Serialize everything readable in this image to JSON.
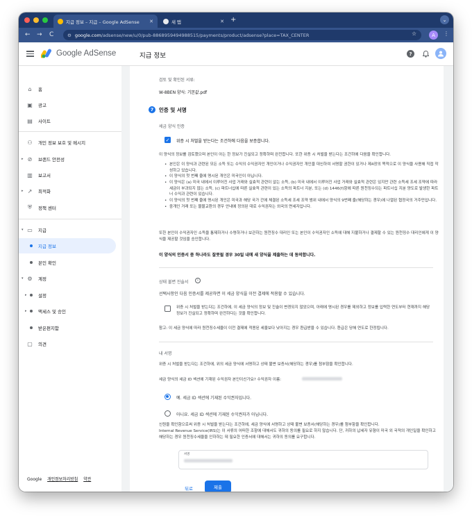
{
  "browser": {
    "tabs": [
      {
        "title": "지급 정보 – 지급 – Google AdSense",
        "close": "✕"
      },
      {
        "title": "새 탭",
        "close": "✕"
      }
    ],
    "new_tab": "+",
    "tab_menu": "⌄",
    "url_domain": "google.com",
    "url_path": "/adsense/new/u/0/pub-8868959494988515/payments/product/adsense?place=TAX_CENTER",
    "profile_initial": "A",
    "nav_back": "←",
    "nav_forward": "→",
    "nav_reload": "C",
    "star": "☆",
    "kebab": "⋮"
  },
  "header": {
    "brand": "Google AdSense",
    "page_title": "지급 정보",
    "help": "?",
    "bell": "🔔",
    "avatar": "👤"
  },
  "sidebar": {
    "items": [
      {
        "label": "홈",
        "icon": "home-icon"
      },
      {
        "label": "광고",
        "icon": "ads-icon"
      },
      {
        "label": "사이트",
        "icon": "sites-icon"
      },
      {
        "label": "개인 정보 보호 및 메시지",
        "icon": "privacy-icon"
      },
      {
        "label": "브랜드 안전성",
        "icon": "block-icon"
      },
      {
        "label": "보고서",
        "icon": "reports-icon"
      },
      {
        "label": "최적화",
        "icon": "optimize-icon"
      },
      {
        "label": "정책 센터",
        "icon": "policy-icon"
      },
      {
        "label": "지급",
        "icon": "payments-icon"
      },
      {
        "label": "지급 정보"
      },
      {
        "label": "본인 확인"
      },
      {
        "label": "계정",
        "icon": "account-icon"
      },
      {
        "label": "설정"
      },
      {
        "label": "액세스 및 승인"
      },
      {
        "label": "받은편지함"
      },
      {
        "label": "의견",
        "icon": "feedback-icon"
      }
    ],
    "footer": {
      "google": "Google",
      "privacy": "개인정보처리방침",
      "terms": "약관"
    }
  },
  "form": {
    "review_docs_label": "검토 및 확인된 서류:",
    "review_docs_value": "W-8BEN 양식: 기본값.pdf",
    "step_number": "7",
    "section_title": "인증 및 서명",
    "tax_form_cert_label": "세금 양식 인증",
    "perjury_checkbox_label": "위증 시 처벌을 받는다는 조건하에 다음을 보증합니다.",
    "intro_paragraph": "이 양식의 정보를 검토했으며 본인이 아는 한 정보가 진실되고 정확하며 완전합니다. 또한 위증 시 처벌을 받는다는 조건하에 다음을 확인합니다.",
    "bullets": [
      "본인은 이 양식과 관련된 모든 소득 또는 수익의 수익권자인 개인이거나 수익권자인 개인을 대신하여 서명할 권한이 있거나 제4장의 목적으로 이 양식을 사용해 직접 작성하고 있습니다.",
      "이 양식의 첫 번째 줄에 명시된 개인은 미국인이 아닙니다.",
      "이 양식은 (a) 미국 내에서 이루어진 사업 거래와 실효적 관련이 없는 소득, (b) 미국 내에서 이루어진 사업 거래와 실효적 관련은 있지만 관련 소득세 조세 조약에 따라 세금이 부과되지 않는 소득, (c) 파트너십에 따른 실효적 관련이 있는 소득의 파트너 지분, 또는 (d) 1446(f)항에 따른 원천징수되는 파트너십 지분 양도로 발생한 파트너 수익과 관련이 있습니다.",
      "이 양식의 첫 번째 줄에 명시된 개인은 미국과 해당 국가 간에 체결된 소득세 조세 조약 범위 내에서 양식의 9번째 줄(해당하는 경우)에 나열된 협정국의 거주민입니다.",
      "중개인 거래 또는 물물교환의 경우 안내에 정의된 대로 수익권자는 외국의 면세자입니다."
    ],
    "authorize_paragraph": "또한 본인이 수익권자인 소득을 통제하거나 수령하거나 보관하는 원천징수 대리인 또는 본인이 수익권자인 소득에 대해 지불하거나 결제할 수 있는 원천징수 대리인에게 이 양식을 제공할 것임을 승인합니다.",
    "agree_30_days": "이 양식의 인증서 중 하나라도 잘못될 경우 30일 내에 새 양식을 제출하는 데 동의합니다.",
    "status_label": "상태 불변 진술서",
    "status_info": "i",
    "status_desc": "선택사항인 다음 인증서를 제공하면 이 세금 양식을 이전 결제에 적용할 수 있습니다.",
    "status_checkbox_label": "위증 시 처벌을 받는다는 조건하에, 이 세금 양식의 정보 및 진술이 변경되지 않았으며, 아래에 명시된 경우를 제외하고 정보를 입력한 연도부터 현재까지 해당 정보가 진실되고 정확하며 완전하다는 것을 확인합니다.",
    "status_note": "참고: 이 세금 양식에 따라 원천징수세율이 이전 결제에 적용된 세율보다 낮아지는 경우 환급받을 수 있습니다. 환급은 당해 연도로 한정됩니다.",
    "signature_label": "내 서명",
    "signature_desc": "위증 시 처벌을 받는다는 조건하에, 위의 세금 양식에 서명하고 상태 불변 보증서(해당하는 경우)를 첨부함을 확인합니다.",
    "question": "세금 양식의 세금 ID 섹션에 기재된 수익권자 본인이신가요? 수익권자 이름:",
    "radio_yes": "예. 세금 ID 섹션에 기재된 수익권자입니다.",
    "radio_no": "아니요. 세금 ID 섹션에 기재된 수익권자가 아닙니다.",
    "final_paragraph_1": "신원을 확인함으로써 위증 시 처벌을 받는다는 조건하에, 세금 양식에 서명하고 상태 불변 보증서(해당하는 경우)를 첨부함을 확인합니다.",
    "final_paragraph_2": "Internal Revenue Service(IRS)는 이 서류의 어떠한 조항에 대해서도 귀하의 동의를 필요로 하지 않습니다. 단, 귀하의 납세자 유형이 미국 외 국적의 개인일을 확인하고 해당하는 경우 원천징수세율을 인하하는 데 필요한 인증서에 대해서는 귀하의 동의를 요구합니다.",
    "sig_field_label": "서명",
    "back_button": "뒤로",
    "submit_button": "제출"
  },
  "colors": {
    "accent": "#1a73e8",
    "tabbar": "#1f3a6b",
    "toolbar": "#35548c"
  }
}
